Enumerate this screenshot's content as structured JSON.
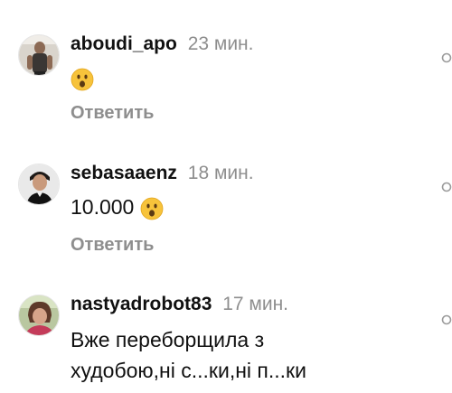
{
  "comments": [
    {
      "username": "aboudi_apo",
      "time": "23 мин.",
      "text": "",
      "emoji": "hushed-face",
      "reply_label": "Ответить"
    },
    {
      "username": "sebasaaenz",
      "time": "18 мин.",
      "text": "10.000",
      "emoji": "hushed-face",
      "reply_label": "Ответить"
    },
    {
      "username": "nastyadrobot83",
      "time": "17 мин.",
      "text_line1": "Вже переборщила з",
      "text_line2": "худобою,ні с...ки,ні п...ки"
    }
  ],
  "colors": {
    "username": "#111111",
    "meta_gray": "#8e8e8e",
    "emoji_yellow": "#f7c33b"
  },
  "icons": [
    "heart-outline-icon",
    "hushed-face-emoji"
  ]
}
